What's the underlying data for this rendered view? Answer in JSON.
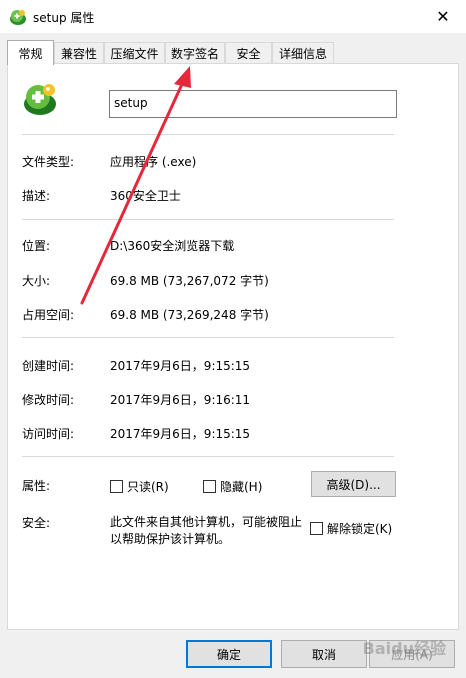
{
  "window": {
    "title": "setup 属性",
    "close_glyph": "✕"
  },
  "tabs": [
    {
      "label": "常规",
      "active": true
    },
    {
      "label": "兼容性"
    },
    {
      "label": "压缩文件"
    },
    {
      "label": "数字签名"
    },
    {
      "label": "安全"
    },
    {
      "label": "详细信息"
    }
  ],
  "general": {
    "file_name": "setup",
    "file_type_label": "文件类型:",
    "file_type_value": "应用程序 (.exe)",
    "description_label": "描述:",
    "description_value": "360安全卫士",
    "location_label": "位置:",
    "location_value": "D:\\360安全浏览器下载",
    "size_label": "大小:",
    "size_value": "69.8 MB (73,267,072 字节)",
    "size_on_disk_label": "占用空间:",
    "size_on_disk_value": "69.8 MB (73,269,248 字节)",
    "created_label": "创建时间:",
    "created_value": "2017年9月6日，9:15:15",
    "modified_label": "修改时间:",
    "modified_value": "2017年9月6日，9:16:11",
    "accessed_label": "访问时间:",
    "accessed_value": "2017年9月6日，9:15:15",
    "attributes_label": "属性:",
    "readonly_label": "只读(R)",
    "hidden_label": "隐藏(H)",
    "advanced_button": "高级(D)...",
    "security_label": "安全:",
    "security_text": "此文件来自其他计算机，可能被阻止以帮助保护该计算机。",
    "unblock_label": "解除锁定(K)"
  },
  "buttons": {
    "ok": "确定",
    "cancel": "取消",
    "apply": "应用(A)"
  },
  "watermark_text": "Baidu经验",
  "colors": {
    "accent": "#0078d7",
    "annotation_arrow": "#e5283c"
  },
  "icons": {
    "app_icon": "360-safeguard-icon",
    "close": "close-icon"
  }
}
